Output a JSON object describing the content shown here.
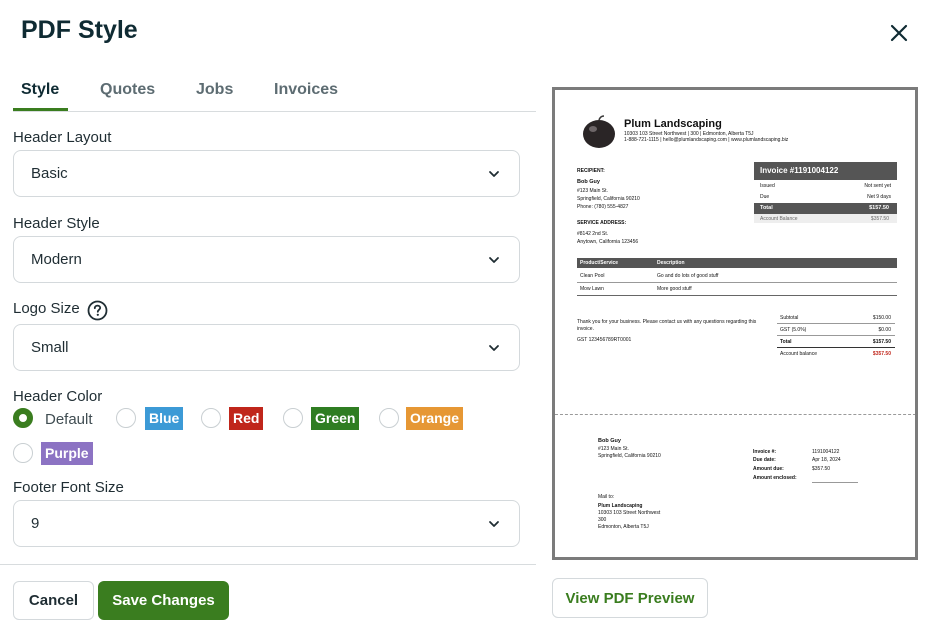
{
  "dialog": {
    "title": "PDF Style",
    "close_icon": "close-icon"
  },
  "tabs": [
    {
      "label": "Style",
      "active": true
    },
    {
      "label": "Quotes",
      "active": false
    },
    {
      "label": "Jobs",
      "active": false
    },
    {
      "label": "Invoices",
      "active": false
    }
  ],
  "form": {
    "header_layout": {
      "label": "Header Layout",
      "value": "Basic"
    },
    "header_style": {
      "label": "Header Style",
      "value": "Modern"
    },
    "logo_size": {
      "label": "Logo Size",
      "value": "Small",
      "help_icon": "question-circle-icon"
    },
    "header_color": {
      "label": "Header Color",
      "selected": "Default",
      "options": [
        {
          "label": "Default",
          "color": ""
        },
        {
          "label": "Blue",
          "color": "#3c9ad6"
        },
        {
          "label": "Red",
          "color": "#c0261b"
        },
        {
          "label": "Green",
          "color": "#2f7d22"
        },
        {
          "label": "Orange",
          "color": "#e69734"
        },
        {
          "label": "Purple",
          "color": "#8c73c3"
        }
      ]
    },
    "footer_font_size": {
      "label": "Footer Font Size",
      "value": "9"
    }
  },
  "buttons": {
    "cancel": "Cancel",
    "save": "Save Changes",
    "preview": "View PDF Preview"
  },
  "colors": {
    "accent": "#3a7d1f",
    "title": "#0f2b33"
  },
  "pdf": {
    "company": "Plum Landscaping",
    "company_address": "10303 103 Street Northwest  |  300  |  Edmonton, Alberta T5J",
    "company_contact": "1-888-721-1115  |  hello@plumlandscaping.com  |  www.plumlandscaping.biz",
    "recipient_label": "RECIPIENT:",
    "recipient_name": "Bob Guy",
    "recipient_addr1": "#123 Main St.",
    "recipient_addr2": "Springfield, California 90210",
    "recipient_phone": "Phone: (780) 555-4827",
    "service_label": "SERVICE ADDRESS:",
    "service_addr1": "#8142 2nd St.",
    "service_addr2": "Anytown, California 123456",
    "invoice_title": "Invoice #1191004122",
    "issued_label": "Issued",
    "issued_value": "Not sent yet",
    "due_label": "Due",
    "due_value": "Net 9 days",
    "total_label": "Total",
    "total_value": "$157.50",
    "balance_label": "Account Balance",
    "balance_value": "$357.50",
    "col_product": "Product/Service",
    "col_description": "Description",
    "items": [
      {
        "product": "Clean Pool",
        "description": "Go and do lots of good stuff"
      },
      {
        "product": "Mow Lawn",
        "description": "More good stuff"
      }
    ],
    "thanks": "Thank you for your business. Please contact us with any questions regarding this invoice.",
    "gst_number": "GST 123456789RT0001",
    "subtotal_label": "Subtotal",
    "subtotal_value": "$150.00",
    "gst_label": "GST (5.0%)",
    "gst_value": "$0.00",
    "sum_total_label": "Total",
    "sum_total_value": "$157.50",
    "acct_balance_label": "Account balance",
    "acct_balance_value": "$357.50",
    "stub_name": "Bob Guy",
    "stub_addr1": "#123 Main St.",
    "stub_addr2": "Springfield, California 90210",
    "stub_invoice_label": "Invoice #:",
    "stub_invoice_value": "1191004122",
    "stub_due_label": "Due date:",
    "stub_due_value": "Apr 18, 2024",
    "stub_amount_label": "Amount due:",
    "stub_amount_value": "$357.50",
    "stub_enclosed_label": "Amount enclosed:",
    "mail_to": "Mail to:",
    "mail_name": "Plum Landscaping",
    "mail_addr1": "10303 103 Street Northwest",
    "mail_addr2": "300",
    "mail_addr3": "Edmonton, Alberta T5J"
  }
}
